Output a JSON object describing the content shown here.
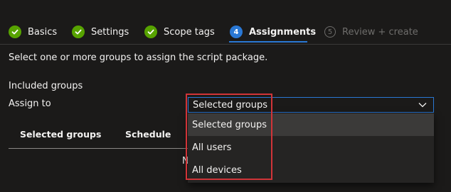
{
  "wizard": {
    "tabs": [
      {
        "label": "Basics",
        "state": "done"
      },
      {
        "label": "Settings",
        "state": "done"
      },
      {
        "label": "Scope tags",
        "state": "done"
      },
      {
        "label": "Assignments",
        "state": "current",
        "number": "4"
      },
      {
        "label": "Review + create",
        "state": "pending",
        "number": "5"
      }
    ]
  },
  "main": {
    "description": "Select one or more groups to assign the script package.",
    "section_title": "Included groups",
    "assign_label": "Assign to",
    "assign_value": "Selected groups",
    "table": {
      "columns": [
        "Selected groups",
        "Schedule"
      ],
      "partial_text": "N"
    },
    "dropdown": {
      "options": [
        "Selected groups",
        "All users",
        "All devices"
      ],
      "selected": "Selected groups"
    }
  },
  "colors": {
    "accent": "#2a78d4",
    "success": "#57a300",
    "highlight": "#d13438",
    "background": "#1b1a19"
  }
}
